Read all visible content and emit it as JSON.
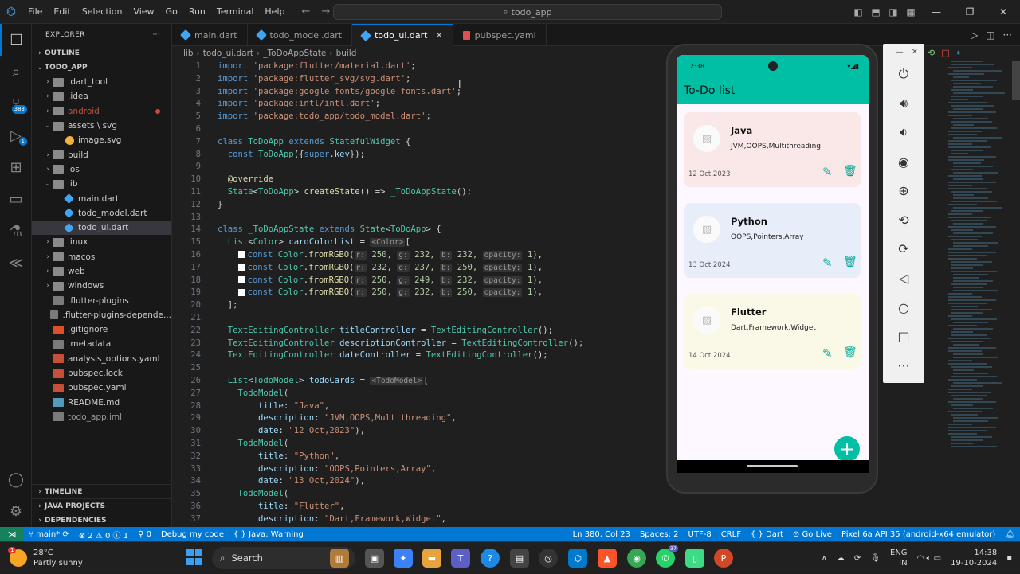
{
  "menu": [
    "File",
    "Edit",
    "Selection",
    "View",
    "Go",
    "Run",
    "Terminal",
    "Help"
  ],
  "search": {
    "text": "todo_app"
  },
  "activity_badges": {
    "source_control": "383",
    "run": "1"
  },
  "explorer": {
    "title": "EXPLORER",
    "outline": "OUTLINE",
    "project": "TODO_APP",
    "items": [
      {
        "label": ".dart_tool",
        "type": "folder",
        "depth": 1,
        "chev": "›"
      },
      {
        "label": ".idea",
        "type": "folder",
        "depth": 1,
        "chev": "›"
      },
      {
        "label": "android",
        "type": "folder",
        "depth": 1,
        "chev": "›",
        "color": "#c74e39",
        "dot": true
      },
      {
        "label": "assets \\ svg",
        "type": "folder",
        "depth": 1,
        "chev": "⌄"
      },
      {
        "label": "image.svg",
        "type": "svg",
        "depth": 2
      },
      {
        "label": "build",
        "type": "folder",
        "depth": 1,
        "chev": "›"
      },
      {
        "label": "ios",
        "type": "folder",
        "depth": 1,
        "chev": "›"
      },
      {
        "label": "lib",
        "type": "folder",
        "depth": 1,
        "chev": "⌄"
      },
      {
        "label": "main.dart",
        "type": "dart",
        "depth": 2
      },
      {
        "label": "todo_model.dart",
        "type": "dart",
        "depth": 2
      },
      {
        "label": "todo_ui.dart",
        "type": "dart",
        "depth": 2,
        "selected": true
      },
      {
        "label": "linux",
        "type": "folder",
        "depth": 1,
        "chev": "›"
      },
      {
        "label": "macos",
        "type": "folder",
        "depth": 1,
        "chev": "›"
      },
      {
        "label": "web",
        "type": "folder",
        "depth": 1,
        "chev": "›"
      },
      {
        "label": "windows",
        "type": "folder",
        "depth": 1,
        "chev": "›"
      },
      {
        "label": ".flutter-plugins",
        "type": "file",
        "depth": 1
      },
      {
        "label": ".flutter-plugins-depende...",
        "type": "file",
        "depth": 1
      },
      {
        "label": ".gitignore",
        "type": "git",
        "depth": 1
      },
      {
        "label": ".metadata",
        "type": "file",
        "depth": 1
      },
      {
        "label": "analysis_options.yaml",
        "type": "yaml",
        "depth": 1
      },
      {
        "label": "pubspec.lock",
        "type": "lock",
        "depth": 1
      },
      {
        "label": "pubspec.yaml",
        "type": "yaml",
        "depth": 1
      },
      {
        "label": "README.md",
        "type": "md",
        "depth": 1
      },
      {
        "label": "todo_app.iml",
        "type": "iml",
        "depth": 1
      }
    ],
    "bottom_sections": [
      "TIMELINE",
      "JAVA PROJECTS",
      "DEPENDENCIES"
    ]
  },
  "tabs": [
    {
      "label": "main.dart",
      "type": "dart"
    },
    {
      "label": "todo_model.dart",
      "type": "dart"
    },
    {
      "label": "todo_ui.dart",
      "type": "dart",
      "active": true
    },
    {
      "label": "pubspec.yaml",
      "type": "yaml"
    }
  ],
  "breadcrumb": [
    "lib",
    "todo_ui.dart",
    "_ToDoAppState",
    "build"
  ],
  "code_lines": [
    [
      [
        "import ",
        "kw"
      ],
      [
        "'package:flutter/material.dart'",
        "str"
      ],
      [
        ";",
        ""
      ]
    ],
    [
      [
        "import ",
        "kw"
      ],
      [
        "'package:flutter_svg/svg.dart'",
        "str"
      ],
      [
        ";",
        ""
      ]
    ],
    [
      [
        "import ",
        "kw"
      ],
      [
        "'package:google_fonts/google_fonts.dart'",
        "str"
      ],
      [
        ";",
        ""
      ]
    ],
    [
      [
        "import ",
        "kw"
      ],
      [
        "'package:intl/intl.dart'",
        "str"
      ],
      [
        ";",
        ""
      ]
    ],
    [
      [
        "import ",
        "kw"
      ],
      [
        "'package:todo_app/todo_model.dart'",
        "str"
      ],
      [
        ";",
        ""
      ]
    ],
    [],
    [
      [
        "class ",
        "kw"
      ],
      [
        "ToDoApp ",
        "typ"
      ],
      [
        "extends ",
        "kw"
      ],
      [
        "StatefulWidget ",
        "typ"
      ],
      [
        "{",
        ""
      ]
    ],
    [
      [
        "  const ",
        "kw"
      ],
      [
        "ToDoApp",
        "typ"
      ],
      [
        "({",
        ""
      ],
      [
        "super",
        "kw"
      ],
      [
        ".",
        ""
      ],
      [
        "key",
        "prop"
      ],
      [
        "});",
        ""
      ]
    ],
    [],
    [
      [
        "  @override",
        "ann"
      ]
    ],
    [
      [
        "  State",
        "typ"
      ],
      [
        "<",
        ""
      ],
      [
        "ToDoApp",
        "typ"
      ],
      [
        "> ",
        ""
      ],
      [
        "createState",
        "fn"
      ],
      [
        "() => ",
        ""
      ],
      [
        "_ToDoAppState",
        "typ"
      ],
      [
        "();",
        ""
      ]
    ],
    [
      [
        "}",
        ""
      ]
    ],
    [],
    [
      [
        "class ",
        "kw"
      ],
      [
        "_ToDoAppState ",
        "typ"
      ],
      [
        "extends ",
        "kw"
      ],
      [
        "State",
        "typ"
      ],
      [
        "<",
        ""
      ],
      [
        "ToDoApp",
        "typ"
      ],
      [
        "> {",
        ""
      ]
    ],
    [
      [
        "  List",
        "typ"
      ],
      [
        "<",
        ""
      ],
      [
        "Color",
        "typ"
      ],
      [
        "> ",
        ""
      ],
      [
        "cardColorList ",
        "prop"
      ],
      [
        "= ",
        ""
      ],
      [
        "<Color>",
        "hint"
      ],
      [
        "[",
        ""
      ]
    ],
    [
      [
        "    ",
        "sq"
      ],
      [
        "const ",
        "kw"
      ],
      [
        "Color",
        "typ"
      ],
      [
        ".",
        ""
      ],
      [
        "fromRGBO",
        "fn"
      ],
      [
        "(",
        ""
      ],
      [
        "r:",
        "hint"
      ],
      [
        " 250, ",
        "num"
      ],
      [
        "g:",
        "hint"
      ],
      [
        " 232, ",
        "num"
      ],
      [
        "b:",
        "hint"
      ],
      [
        " 232, ",
        "num"
      ],
      [
        "opacity:",
        "hint"
      ],
      [
        " 1",
        "num"
      ],
      [
        "),",
        ""
      ]
    ],
    [
      [
        "    ",
        "sq"
      ],
      [
        "const ",
        "kw"
      ],
      [
        "Color",
        "typ"
      ],
      [
        ".",
        ""
      ],
      [
        "fromRGBO",
        "fn"
      ],
      [
        "(",
        ""
      ],
      [
        "r:",
        "hint"
      ],
      [
        " 232, ",
        "num"
      ],
      [
        "g:",
        "hint"
      ],
      [
        " 237, ",
        "num"
      ],
      [
        "b:",
        "hint"
      ],
      [
        " 250, ",
        "num"
      ],
      [
        "opacity:",
        "hint"
      ],
      [
        " 1",
        "num"
      ],
      [
        "),",
        ""
      ]
    ],
    [
      [
        "    ",
        "sq"
      ],
      [
        "const ",
        "kw"
      ],
      [
        "Color",
        "typ"
      ],
      [
        ".",
        ""
      ],
      [
        "fromRGBO",
        "fn"
      ],
      [
        "(",
        ""
      ],
      [
        "r:",
        "hint"
      ],
      [
        " 250, ",
        "num"
      ],
      [
        "g:",
        "hint"
      ],
      [
        " 249, ",
        "num"
      ],
      [
        "b:",
        "hint"
      ],
      [
        " 232, ",
        "num"
      ],
      [
        "opacity:",
        "hint"
      ],
      [
        " 1",
        "num"
      ],
      [
        "),",
        ""
      ]
    ],
    [
      [
        "    ",
        "sq"
      ],
      [
        "const ",
        "kw"
      ],
      [
        "Color",
        "typ"
      ],
      [
        ".",
        ""
      ],
      [
        "fromRGBO",
        "fn"
      ],
      [
        "(",
        ""
      ],
      [
        "r:",
        "hint"
      ],
      [
        " 250, ",
        "num"
      ],
      [
        "g:",
        "hint"
      ],
      [
        " 232, ",
        "num"
      ],
      [
        "b:",
        "hint"
      ],
      [
        " 250, ",
        "num"
      ],
      [
        "opacity:",
        "hint"
      ],
      [
        " 1",
        "num"
      ],
      [
        "),",
        ""
      ]
    ],
    [
      [
        "  ];",
        ""
      ]
    ],
    [],
    [
      [
        "  TextEditingController ",
        "typ"
      ],
      [
        "titleController ",
        "prop"
      ],
      [
        "= ",
        ""
      ],
      [
        "TextEditingController",
        "typ"
      ],
      [
        "();",
        ""
      ]
    ],
    [
      [
        "  TextEditingController ",
        "typ"
      ],
      [
        "descriptionController ",
        "prop"
      ],
      [
        "= ",
        ""
      ],
      [
        "TextEditingController",
        "typ"
      ],
      [
        "();",
        ""
      ]
    ],
    [
      [
        "  TextEditingController ",
        "typ"
      ],
      [
        "dateController ",
        "prop"
      ],
      [
        "= ",
        ""
      ],
      [
        "TextEditingController",
        "typ"
      ],
      [
        "();",
        ""
      ]
    ],
    [],
    [
      [
        "  List",
        "typ"
      ],
      [
        "<",
        ""
      ],
      [
        "TodoModel",
        "typ"
      ],
      [
        "> ",
        ""
      ],
      [
        "todoCards ",
        "prop"
      ],
      [
        "= ",
        ""
      ],
      [
        "<TodoModel>",
        "hint"
      ],
      [
        "[",
        ""
      ]
    ],
    [
      [
        "    TodoModel",
        "typ"
      ],
      [
        "(",
        ""
      ]
    ],
    [
      [
        "        title",
        "prop"
      ],
      [
        ": ",
        ""
      ],
      [
        "\"Java\"",
        "str"
      ],
      [
        ",",
        ""
      ]
    ],
    [
      [
        "        description",
        "prop"
      ],
      [
        ": ",
        ""
      ],
      [
        "\"JVM,OOPS,Multithreading\"",
        "str"
      ],
      [
        ",",
        ""
      ]
    ],
    [
      [
        "        date",
        "prop"
      ],
      [
        ": ",
        ""
      ],
      [
        "\"12 Oct,2023\"",
        "str"
      ],
      [
        "),",
        ""
      ]
    ],
    [
      [
        "    TodoModel",
        "typ"
      ],
      [
        "(",
        ""
      ]
    ],
    [
      [
        "        title",
        "prop"
      ],
      [
        ": ",
        ""
      ],
      [
        "\"Python\"",
        "str"
      ],
      [
        ",",
        ""
      ]
    ],
    [
      [
        "        description",
        "prop"
      ],
      [
        ": ",
        ""
      ],
      [
        "\"OOPS,Pointers,Array\"",
        "str"
      ],
      [
        ",",
        ""
      ]
    ],
    [
      [
        "        date",
        "prop"
      ],
      [
        ": ",
        ""
      ],
      [
        "\"13 Oct,2024\"",
        "str"
      ],
      [
        "),",
        ""
      ]
    ],
    [
      [
        "    TodoModel",
        "typ"
      ],
      [
        "(",
        ""
      ]
    ],
    [
      [
        "        title",
        "prop"
      ],
      [
        ": ",
        ""
      ],
      [
        "\"Flutter\"",
        "str"
      ],
      [
        ",",
        ""
      ]
    ],
    [
      [
        "        description",
        "prop"
      ],
      [
        ": ",
        ""
      ],
      [
        "\"Dart,Framework,Widget\"",
        "str"
      ],
      [
        ",",
        ""
      ]
    ]
  ],
  "phone": {
    "time": "2:38",
    "app_title": "To-Do list",
    "cards": [
      {
        "title": "Java",
        "description": "JVM,OOPS,Multithreading",
        "date": "12 Oct,2023",
        "color": "#fae8e8"
      },
      {
        "title": "Python",
        "description": "OOPS,Pointers,Array",
        "date": "13 Oct,2024",
        "color": "#e8edfa"
      },
      {
        "title": "Flutter",
        "description": "Dart,Framework,Widget",
        "date": "14 Oct,2024",
        "color": "#faf9e8"
      }
    ]
  },
  "statusbar": {
    "branch": "main*",
    "problems": "⊗ 2 ⚠ 0 ⓘ 1",
    "ports": "⚲ 0",
    "debug": "Debug my code",
    "java": "{ } Java: Warning",
    "position": "Ln 380, Col 23",
    "spaces": "Spaces: 2",
    "encoding": "UTF-8",
    "eol": "CRLF",
    "language": "{ } Dart",
    "golive": "⊙ Go Live",
    "device": "Pixel 6a API 35 (android-x64 emulator)"
  },
  "taskbar": {
    "temp": "28°C",
    "weather": "Partly sunny",
    "weather_badge": "1",
    "search": "Search",
    "whatsapp_badge": "37",
    "lang1": "ENG",
    "lang2": "IN",
    "time": "14:38",
    "date": "19-10-2024"
  },
  "colors": {
    "accent": "#0078d4",
    "teal": "#00bfa5"
  }
}
